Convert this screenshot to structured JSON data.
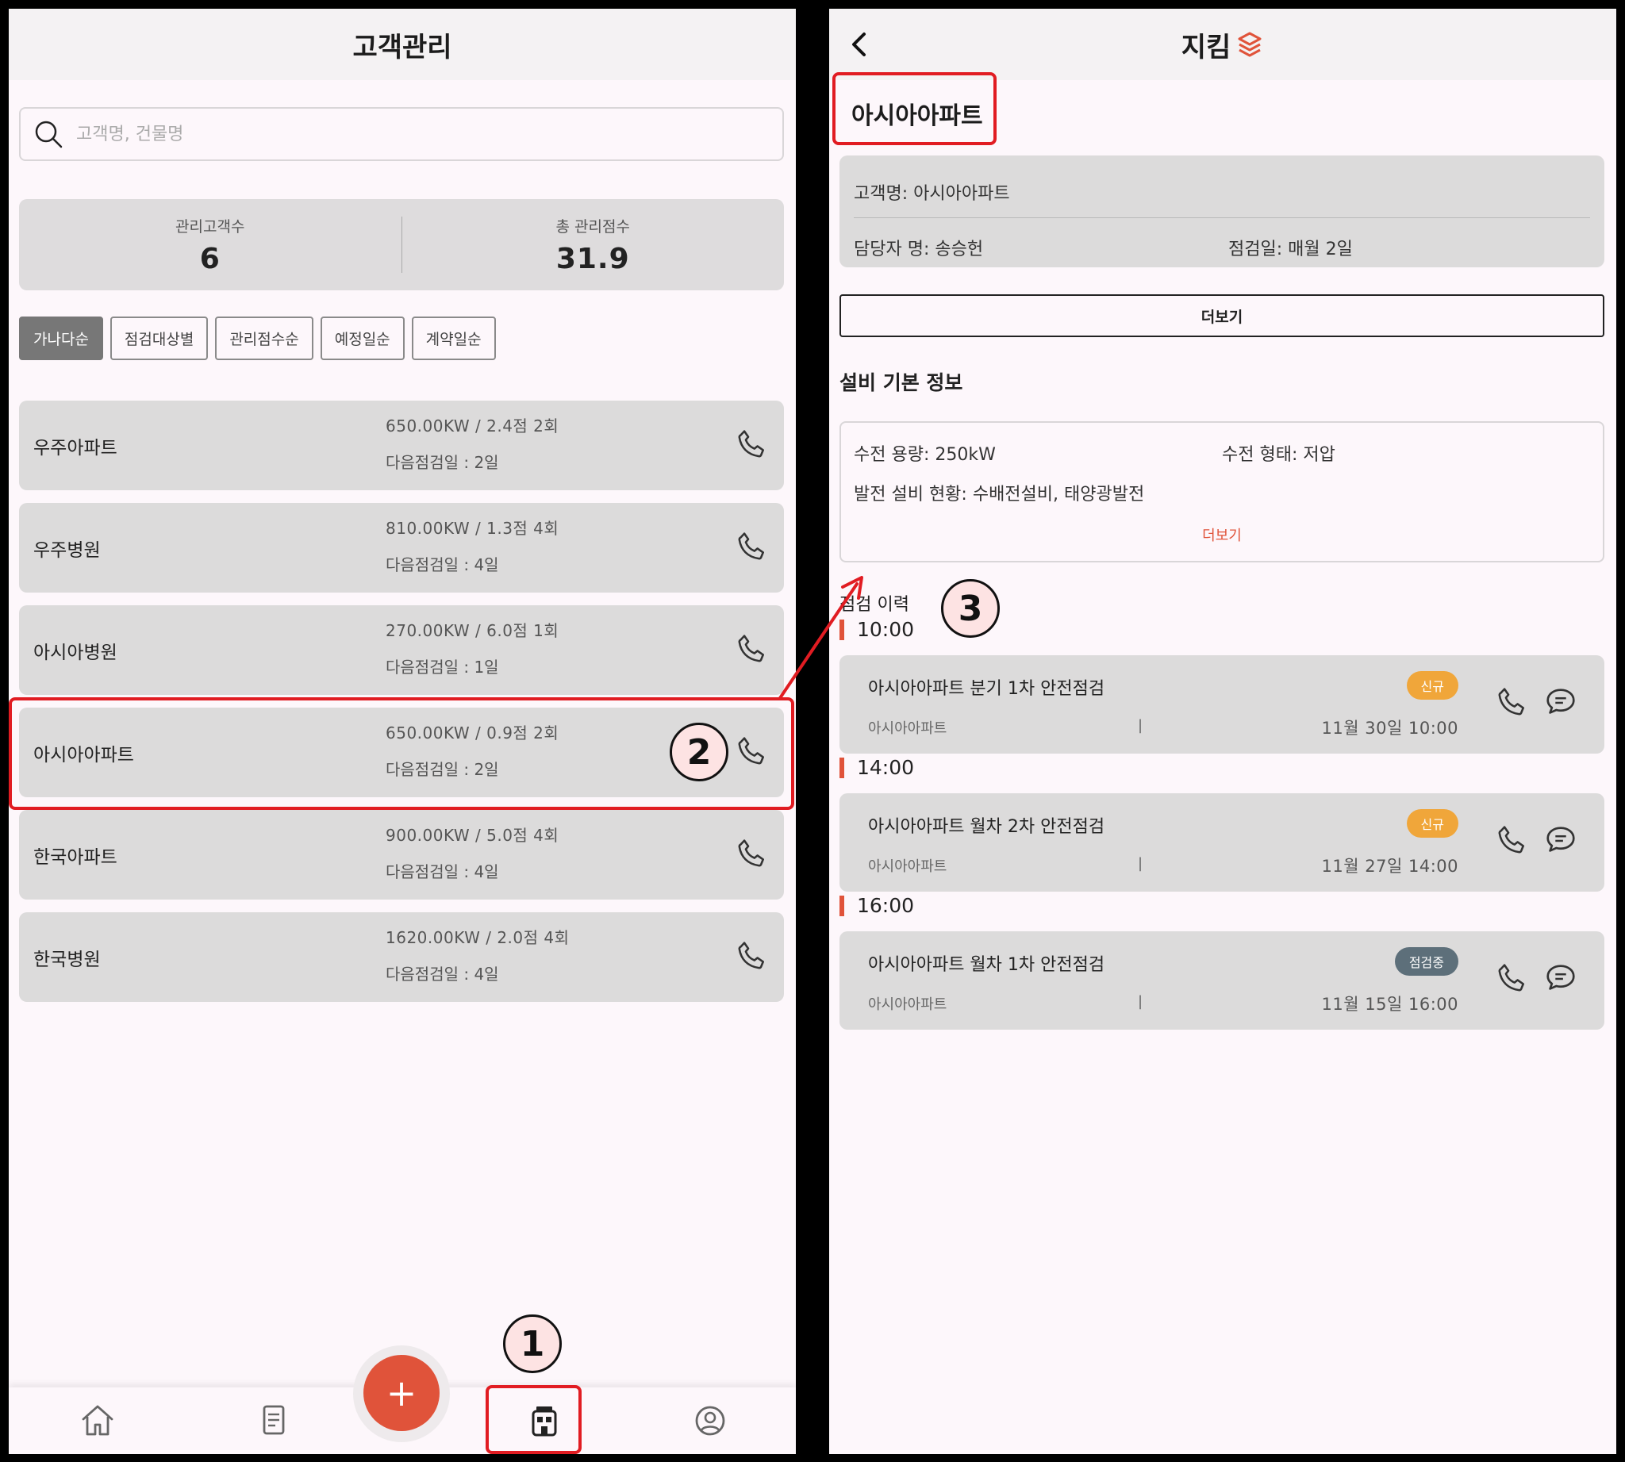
{
  "left": {
    "title": "고객관리",
    "search_placeholder": "고객명, 건물명",
    "stats": {
      "customers_label": "관리고객수",
      "customers_value": "6",
      "score_label": "총 관리점수",
      "score_value": "31.9"
    },
    "filters": [
      "가나다순",
      "점검대상별",
      "관리점수순",
      "예정일순",
      "계약일순"
    ],
    "active_filter": "가나다순",
    "customers": [
      {
        "name": "우주아파트",
        "spec": "650.00KW / 2.4점 2회",
        "next": "다음점검일 : 2일"
      },
      {
        "name": "우주병원",
        "spec": "810.00KW / 1.3점 4회",
        "next": "다음점검일 : 4일"
      },
      {
        "name": "아시아병원",
        "spec": "270.00KW / 6.0점 1회",
        "next": "다음점검일 : 1일"
      },
      {
        "name": "아시아아파트",
        "spec": "650.00KW / 0.9점 2회",
        "next": "다음점검일 : 2일"
      },
      {
        "name": "한국아파트",
        "spec": "900.00KW / 5.0점 4회",
        "next": "다음점검일 : 4일"
      },
      {
        "name": "한국병원",
        "spec": "1620.00KW / 2.0점 4회",
        "next": "다음점검일 : 4일"
      }
    ],
    "fab_label": "+",
    "nav_icons": [
      "home-icon",
      "document-icon",
      "building-icon",
      "profile-icon"
    ]
  },
  "right": {
    "title": "지킴",
    "page_title": "아시아아파트",
    "info": {
      "customer": "고객명: 아시아아파트",
      "manager": "담당자 명: 송승헌",
      "inspection_day": "점검일: 매월 2일"
    },
    "more_button": "더보기",
    "section_title": "설비 기본 정보",
    "equipment": {
      "capacity": "수전 용량: 250kW",
      "type": "수전 형태: 저압",
      "status": "발전 설비 현황: 수배전설비, 태양광발전",
      "more_link": "더보기"
    },
    "history_title": "점검 이력",
    "inspections": [
      {
        "time": "10:00",
        "title": "아시아아파트 분기 1차 안전점검",
        "badge": "신규",
        "client": "아시아아파트",
        "pipe": "|",
        "date": "11월 30일 10:00"
      },
      {
        "time": "14:00",
        "title": "아시아아파트 월차 2차 안전점검",
        "badge": "신규",
        "client": "아시아아파트",
        "pipe": "|",
        "date": "11월 27일 14:00"
      },
      {
        "time": "16:00",
        "title": "아시아아파트 월차 1차 안전점검",
        "badge": "점검중",
        "client": "아시아아파트",
        "pipe": "|",
        "date": "11월 15일 16:00"
      }
    ]
  },
  "annotations": {
    "step1": "1",
    "step2": "2",
    "step3": "3"
  },
  "colors": {
    "accent": "#e0533a",
    "highlight": "#e11c22",
    "badge_new": "#f0a63a",
    "badge_progress": "#5d6f7a",
    "card": "#dcdbdb"
  }
}
